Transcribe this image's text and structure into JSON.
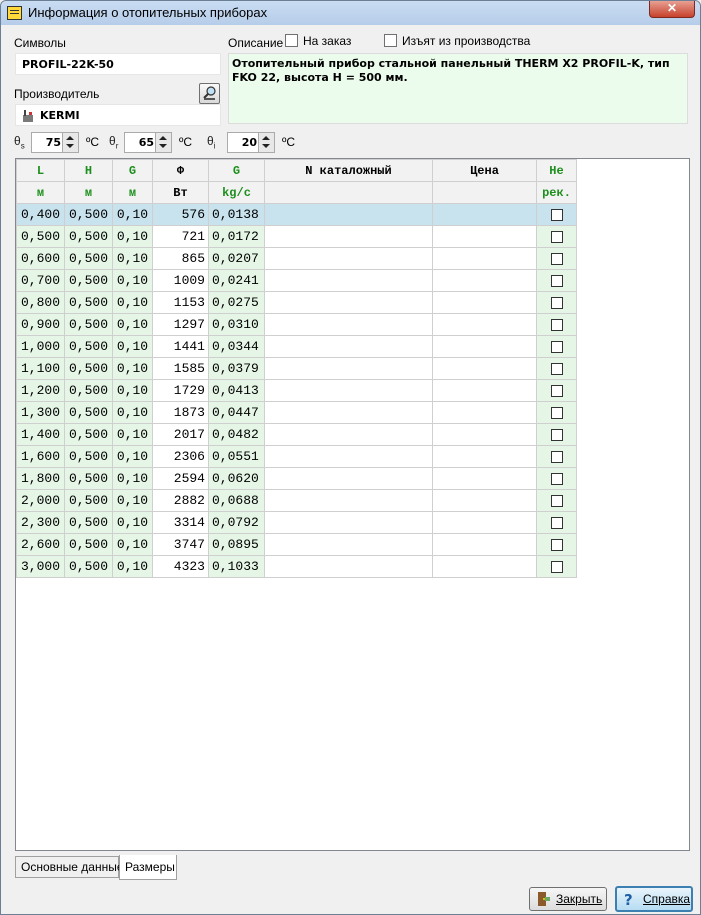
{
  "window": {
    "title": "Информация о отопительных приборах",
    "close": "✕"
  },
  "fields": {
    "symbols_label": "Символы",
    "symbols_value": "PROFIL-22K-50",
    "manufacturer_label": "Производитель",
    "manufacturer_value": "KERMI",
    "description_label": "Описание",
    "on_order_label": "На заказ",
    "discontinued_label": "Изъят из производства",
    "description_value": "Отопительный прибор стальной панельный THERM X2 PROFIL-K, тип FKO 22, высота H = 500 мм."
  },
  "temps": {
    "s": {
      "sym": "θ",
      "sub": "s",
      "value": "75",
      "unit": "ºC"
    },
    "r": {
      "sym": "θ",
      "sub": "r",
      "value": "65",
      "unit": "ºC"
    },
    "i": {
      "sym": "θ",
      "sub": "i",
      "value": "20",
      "unit": "ºC"
    }
  },
  "table": {
    "headers1": [
      "L",
      "H",
      "G",
      "Φ",
      "G",
      "N каталожный",
      "Цена",
      "Не"
    ],
    "headers2": [
      "м",
      "м",
      "м",
      "Вт",
      "kg/c",
      "",
      "",
      "рек."
    ],
    "rows": [
      [
        "0,400",
        "0,500",
        "0,10",
        "576",
        "0,0138"
      ],
      [
        "0,500",
        "0,500",
        "0,10",
        "721",
        "0,0172"
      ],
      [
        "0,600",
        "0,500",
        "0,10",
        "865",
        "0,0207"
      ],
      [
        "0,700",
        "0,500",
        "0,10",
        "1009",
        "0,0241"
      ],
      [
        "0,800",
        "0,500",
        "0,10",
        "1153",
        "0,0275"
      ],
      [
        "0,900",
        "0,500",
        "0,10",
        "1297",
        "0,0310"
      ],
      [
        "1,000",
        "0,500",
        "0,10",
        "1441",
        "0,0344"
      ],
      [
        "1,100",
        "0,500",
        "0,10",
        "1585",
        "0,0379"
      ],
      [
        "1,200",
        "0,500",
        "0,10",
        "1729",
        "0,0413"
      ],
      [
        "1,300",
        "0,500",
        "0,10",
        "1873",
        "0,0447"
      ],
      [
        "1,400",
        "0,500",
        "0,10",
        "2017",
        "0,0482"
      ],
      [
        "1,600",
        "0,500",
        "0,10",
        "2306",
        "0,0551"
      ],
      [
        "1,800",
        "0,500",
        "0,10",
        "2594",
        "0,0620"
      ],
      [
        "2,000",
        "0,500",
        "0,10",
        "2882",
        "0,0688"
      ],
      [
        "2,300",
        "0,500",
        "0,10",
        "3314",
        "0,0792"
      ],
      [
        "2,600",
        "0,500",
        "0,10",
        "3747",
        "0,0895"
      ],
      [
        "3,000",
        "0,500",
        "0,10",
        "4323",
        "0,1033"
      ]
    ]
  },
  "tabs": [
    "Основные данные",
    "Размеры"
  ],
  "buttons": {
    "close": "Закрыть",
    "help": "Справка"
  },
  "colors": {
    "header_green": "#1d8f1d",
    "cell_green": "#e6f6e6",
    "selected_row": "#c8e3ee"
  }
}
